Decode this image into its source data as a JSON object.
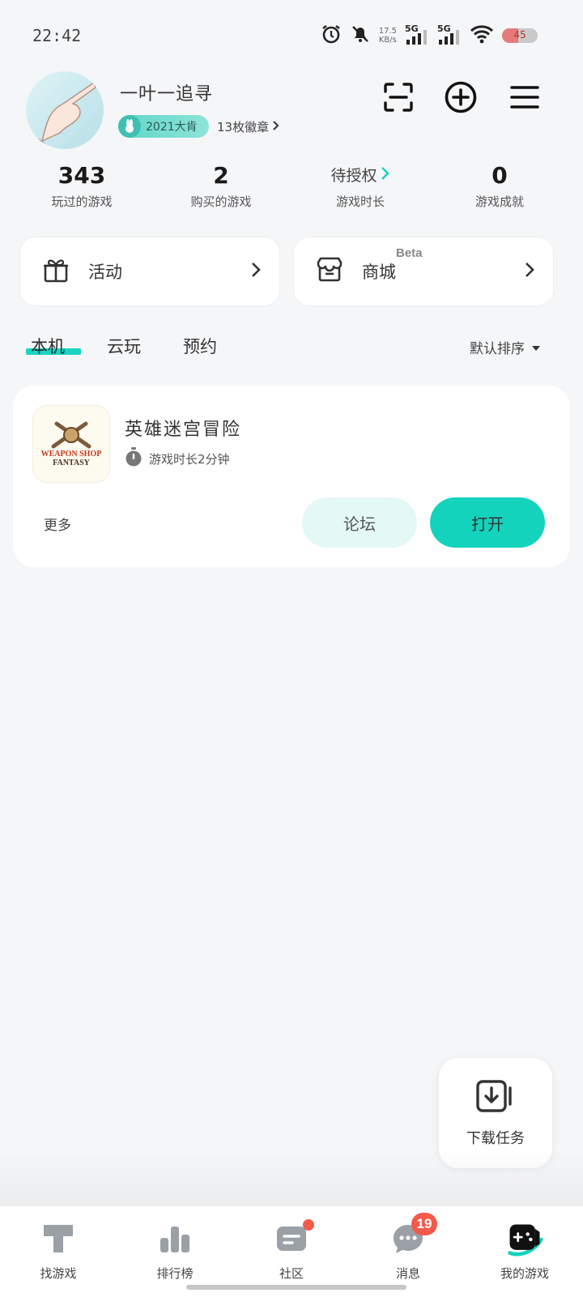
{
  "status_bar": {
    "time": "22:42",
    "net_speed_value": "17.5",
    "net_speed_unit": "KB/s",
    "sim1": "5G",
    "sim2": "5G",
    "battery": "45",
    "battery_level": 0.45
  },
  "profile": {
    "username": "一叶一追寻",
    "year_badge": "2021大肯",
    "badges_link": "13枚徽章"
  },
  "header_icons": [
    "scan-icon",
    "add-circle-icon",
    "menu-icon"
  ],
  "stats": [
    {
      "value": "343",
      "label": "玩过的游戏"
    },
    {
      "value": "2",
      "label": "购买的游戏"
    },
    {
      "value": "待授权",
      "label": "游戏时长"
    },
    {
      "value": "0",
      "label": "游戏成就"
    }
  ],
  "quick_cards": {
    "activity": {
      "label": "活动",
      "icon": "gift-icon"
    },
    "store": {
      "label": "商城",
      "tag": "Beta",
      "icon": "store-icon"
    }
  },
  "tabs": {
    "items": [
      "本机",
      "云玩",
      "预约"
    ],
    "active_index": 0,
    "sort_label": "默认排序"
  },
  "game": {
    "title": "英雄迷宫冒险",
    "icon_text_top": "WEAPON SHOP",
    "icon_text_bottom": "FANTASY",
    "play_time": "游戏时长2分钟",
    "more_label": "更多",
    "forum_label": "论坛",
    "open_label": "打开"
  },
  "download_fab": {
    "label": "下载任务"
  },
  "bottom_nav": [
    {
      "label": "找游戏",
      "icon": "find-games-icon"
    },
    {
      "label": "排行榜",
      "icon": "ranking-icon"
    },
    {
      "label": "社区",
      "icon": "community-icon",
      "dot": true
    },
    {
      "label": "消息",
      "icon": "messages-icon",
      "badge": "19"
    },
    {
      "label": "我的游戏",
      "icon": "my-games-icon",
      "active": true
    }
  ],
  "colors": {
    "accent": "#13d3bd",
    "accent_light": "#e4f8f5",
    "badge_red": "#f25a4c",
    "background": "#f5f6f8"
  }
}
